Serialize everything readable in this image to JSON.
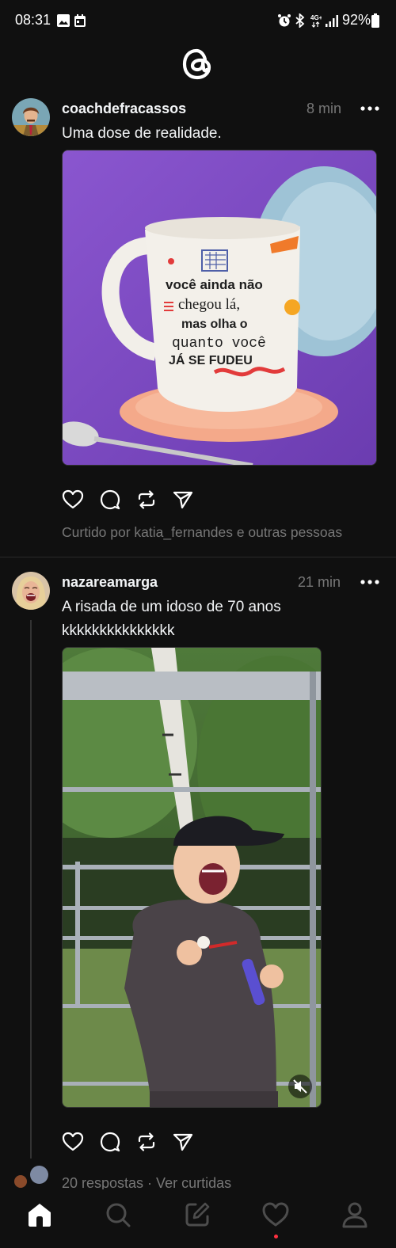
{
  "status_bar": {
    "time": "08:31",
    "network": "4G+",
    "battery": "92%",
    "icons": [
      "gallery-icon",
      "calendar-icon",
      "alarm-icon",
      "bluetooth-icon",
      "signal-icon",
      "battery-icon"
    ]
  },
  "app": {
    "logo": "threads-logo"
  },
  "posts": [
    {
      "username": "coachdefracassos",
      "time": "8 min",
      "caption": "Uma dose de realidade.",
      "image": {
        "mug_text": [
          "você ainda não",
          "chegou lá,",
          "mas olha o",
          "quanto você",
          "JÁ SE FUDEU"
        ]
      },
      "liked_by": "Curtido por katia_fernandes e outras pessoas"
    },
    {
      "username": "nazareamarga",
      "time": "21 min",
      "caption_line1": "A risada de um idoso de 70 anos",
      "caption_line2": "kkkkkkkkkkkkkkk",
      "replies": "20 respostas · Ver curtidas"
    }
  ],
  "nav": [
    "home-icon",
    "search-icon",
    "compose-icon",
    "activity-icon",
    "profile-icon"
  ],
  "colors": {
    "background": "#101010",
    "text": "#f3f5f7",
    "muted": "#777777",
    "notification": "#ff3040"
  }
}
